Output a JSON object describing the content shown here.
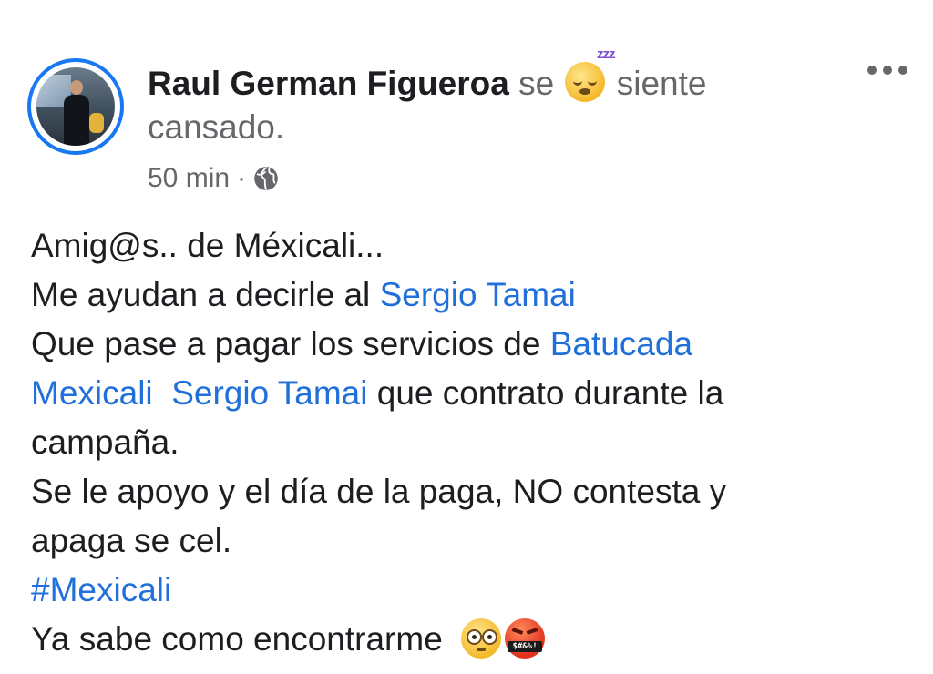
{
  "post": {
    "author": "Raul German Figueroa",
    "feeling_prefix": "se",
    "feeling_suffix": "siente",
    "feeling_line2": "cansado.",
    "feeling_emoji": "sleepy-face",
    "timestamp": "50 min",
    "separator": "·",
    "audience_icon": "globe-icon",
    "menu_icon": "more-options-icon"
  },
  "body": {
    "line1": "Amig@s.. de Méxicali...",
    "line2_text": "Me ayudan a decirle al ",
    "line2_link": "Sergio Tamai",
    "line3_text": "Que pase a pagar los servicios de ",
    "line3_link": "Batucada",
    "line4_link1": "Mexicali",
    "line4_link2": "Sergio Tamai",
    "line4_text": " que contrato durante la",
    "line5": "campaña.",
    "line6": "Se le apoyo y el día de la paga, NO contesta y",
    "line7": "apaga se cel.",
    "hashtag": "#Mexicali",
    "line9": "Ya sabe como encontrarme",
    "end_emojis": [
      "flushed-face",
      "cursing-face"
    ],
    "cursing_symbols": "$#&%!"
  },
  "colors": {
    "link": "#216fdb",
    "secondary_text": "#65676b",
    "avatar_ring": "#1877f2"
  }
}
